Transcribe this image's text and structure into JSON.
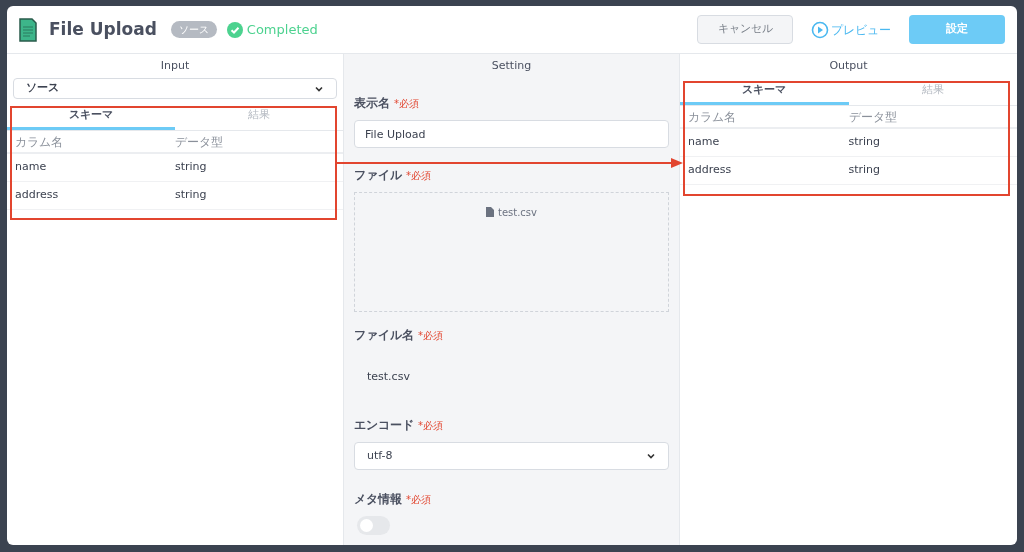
{
  "header": {
    "title": "File Upload",
    "badge": "ソース",
    "status": "Completed",
    "buttons": [
      {
        "kind": "cancel",
        "label": "キャンセル"
      },
      {
        "kind": "preview",
        "label": "プレビュー"
      },
      {
        "kind": "primary",
        "label": "設定"
      }
    ]
  },
  "input": {
    "heading": "Input",
    "select": "ソース",
    "tabs": [
      {
        "label": "スキーマ",
        "selected": true
      },
      {
        "label": "結果",
        "selected": false
      }
    ],
    "columns": [
      "カラム名",
      "データ型"
    ],
    "rows": [
      [
        "name",
        "string"
      ],
      [
        "address",
        "string"
      ]
    ]
  },
  "setting": {
    "heading": "Setting",
    "fields": [
      {
        "kind": "text",
        "label": "表示名",
        "required": "*必須",
        "value": "File Upload"
      },
      {
        "kind": "dropzone",
        "label": "ファイル",
        "required": "*必須",
        "value": "test.csv"
      },
      {
        "kind": "static",
        "label": "ファイル名",
        "required": "*必須",
        "value": "test.csv"
      },
      {
        "kind": "select",
        "label": "エンコード",
        "required": "*必須",
        "value": "utf-8"
      },
      {
        "kind": "toggle",
        "label": "メタ情報",
        "required": "*必須",
        "on": false
      }
    ]
  },
  "output": {
    "heading": "Output",
    "tabs": [
      {
        "label": "スキーマ",
        "selected": true
      },
      {
        "label": "結果",
        "selected": false
      }
    ],
    "columns": [
      "カラム名",
      "データ型"
    ],
    "rows": [
      [
        "name",
        "string"
      ],
      [
        "address",
        "string"
      ]
    ]
  }
}
